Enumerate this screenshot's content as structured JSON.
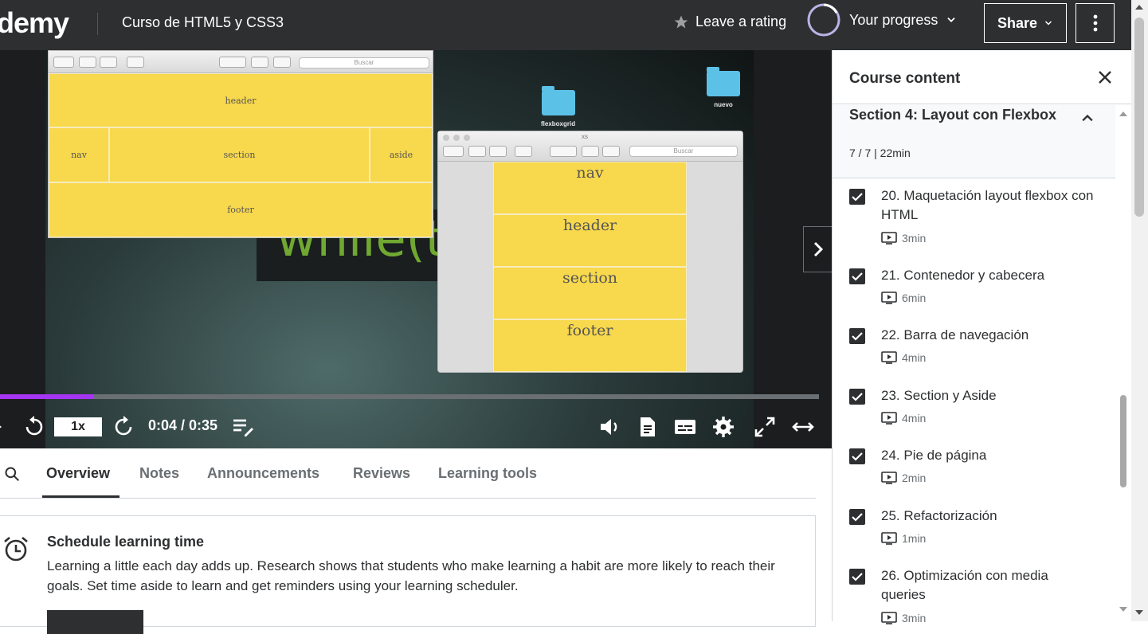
{
  "header": {
    "logo": "demy",
    "course_title": "Curso de HTML5 y CSS3",
    "rating_label": "Leave a rating",
    "progress_label": "Your progress",
    "share_label": "Share"
  },
  "video": {
    "win1_search": "Buscar",
    "win1_cells": [
      "header",
      "nav",
      "section",
      "aside",
      "footer"
    ],
    "win2_title": "xs",
    "win2_search": "Buscar",
    "win2_cells": [
      "nav",
      "header",
      "section",
      "footer"
    ],
    "folders": [
      "flexboxgrid",
      "nuevo"
    ],
    "bg_code": "while(t",
    "progress_fraction": 0.114,
    "speed": "1x",
    "time": "0:04 / 0:35"
  },
  "tabs": [
    "Overview",
    "Notes",
    "Announcements",
    "Reviews",
    "Learning tools"
  ],
  "schedule": {
    "title": "Schedule learning time",
    "text": "Learning a little each day adds up. Research shows that students who make learning a habit are more likely to reach their goals. Set time aside to learn and get reminders using your learning scheduler."
  },
  "sidebar": {
    "title": "Course content",
    "section_title": "Section 4: Layout con Flexbox",
    "section_meta": "7 / 7 | 22min",
    "lectures": [
      {
        "title": "20. Maquetación layout flexbox con HTML",
        "duration": "3min"
      },
      {
        "title": "21. Contenedor y cabecera",
        "duration": "6min"
      },
      {
        "title": "22. Barra de navegación",
        "duration": "4min"
      },
      {
        "title": "23. Section y Aside",
        "duration": "4min"
      },
      {
        "title": "24. Pie de página",
        "duration": "2min"
      },
      {
        "title": "25. Refactorización",
        "duration": "1min"
      },
      {
        "title": "26. Optimización con media queries",
        "duration": "3min"
      }
    ]
  },
  "colors": {
    "header_bg": "#2d2f31",
    "accent_purple": "#a435f0",
    "flex_yellow": "#f8d84c",
    "code_green": "#7ab834"
  }
}
